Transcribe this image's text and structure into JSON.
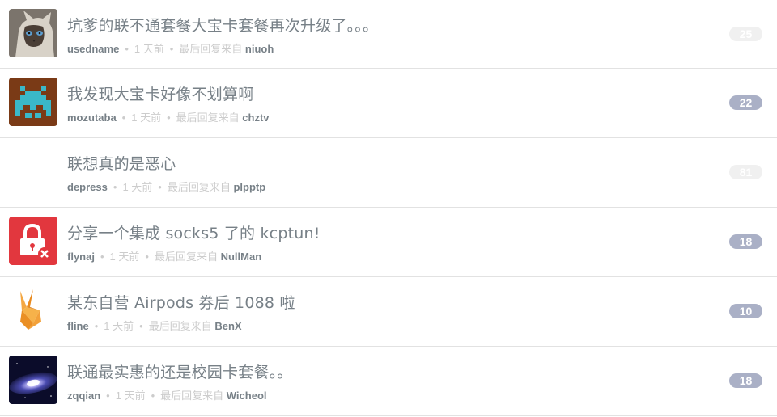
{
  "topics": [
    {
      "title": "坑爹的联不通套餐大宝卡套餐再次升级了。。。",
      "author": "usedname",
      "time": "1 天前",
      "last_reply_prefix": "最后回复来自",
      "last_reply_user": "niuoh",
      "replies": "25",
      "count_bg": "#f0f0f0",
      "avatar": "cat-avatar"
    },
    {
      "title": "我发现大宝卡好像不划算啊",
      "author": "mozutaba",
      "time": "1 天前",
      "last_reply_prefix": "最后回复来自",
      "last_reply_user": "chztv",
      "replies": "22",
      "count_bg": "#aab0c6",
      "avatar": "space-invader-avatar"
    },
    {
      "title": "联想真的是恶心",
      "author": "depress",
      "time": "1 天前",
      "last_reply_prefix": "最后回复来自",
      "last_reply_user": "plpptp",
      "replies": "81",
      "count_bg": "#f0f0f0",
      "avatar": "blank-avatar"
    },
    {
      "title": "分享一个集成 socks5 了的 kcptun!",
      "author": "flynaj",
      "time": "1 天前",
      "last_reply_prefix": "最后回复来自",
      "last_reply_user": "NullMan",
      "replies": "18",
      "count_bg": "#aab0c6",
      "avatar": "red-lock-avatar"
    },
    {
      "title": "某东自营 Airpods 券后 1088 啦",
      "author": "fline",
      "time": "1 天前",
      "last_reply_prefix": "最后回复来自",
      "last_reply_user": "BenX",
      "replies": "10",
      "count_bg": "#aab0c6",
      "avatar": "origami-rabbit-avatar"
    },
    {
      "title": "联通最实惠的还是校园卡套餐。。",
      "author": "zqqian",
      "time": "1 天前",
      "last_reply_prefix": "最后回复来自",
      "last_reply_user": "Wicheol",
      "replies": "18",
      "count_bg": "#aab0c6",
      "avatar": "galaxy-avatar"
    }
  ]
}
